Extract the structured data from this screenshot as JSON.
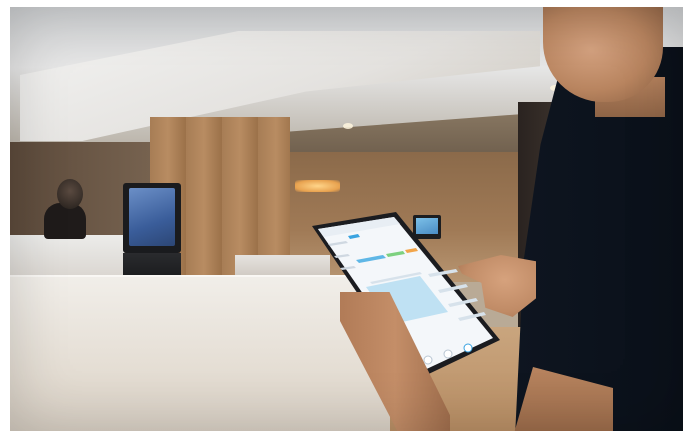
{
  "scene": {
    "kind": "photograph",
    "subject": "hotel-lobby-tablet-use",
    "colors": {
      "accent_ui": "#3aa3e0",
      "wood": "#a77d55",
      "shirt": "#0e1520"
    }
  }
}
